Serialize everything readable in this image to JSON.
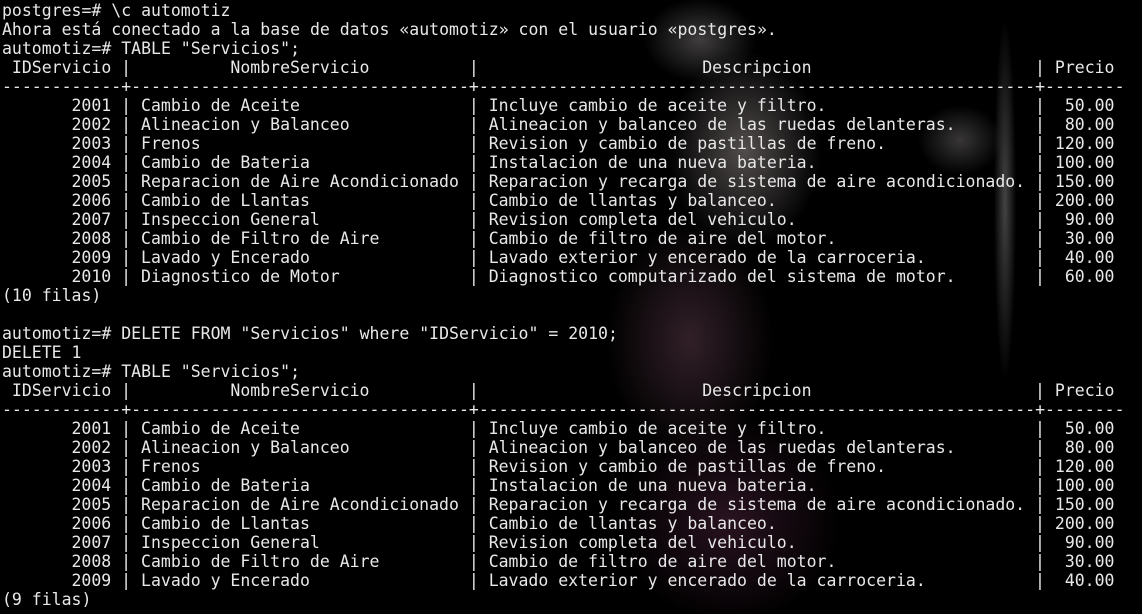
{
  "session": {
    "cmd_connect": "postgres=# \\c automotiz",
    "connect_msg": "Ahora está conectado a la base de datos «automotiz» con el usuario «postgres».",
    "cmd_table1": "automotiz=# TABLE \"Servicios\";",
    "count1": "(10 filas)",
    "cmd_delete": "automotiz=# DELETE FROM \"Servicios\" where \"IDServicio\" = 2010;",
    "delete_result": "DELETE 1",
    "cmd_table2": "automotiz=# TABLE \"Servicios\";",
    "count2": "(9 filas)"
  },
  "table": {
    "sep": "|",
    "headers": [
      "IDServicio",
      "NombreServicio",
      "Descripcion",
      "Precio"
    ],
    "divider": "------------+----------------------------------+--------------------------------------------------------+--------",
    "rows1": [
      [
        "2001",
        "Cambio de Aceite",
        "Incluye cambio de aceite y filtro.",
        "50.00"
      ],
      [
        "2002",
        "Alineacion y Balanceo",
        "Alineacion y balanceo de las ruedas delanteras.",
        "80.00"
      ],
      [
        "2003",
        "Frenos",
        "Revision y cambio de pastillas de freno.",
        "120.00"
      ],
      [
        "2004",
        "Cambio de Bateria",
        "Instalacion de una nueva bateria.",
        "100.00"
      ],
      [
        "2005",
        "Reparacion de Aire Acondicionado",
        "Reparacion y recarga de sistema de aire acondicionado.",
        "150.00"
      ],
      [
        "2006",
        "Cambio de Llantas",
        "Cambio de llantas y balanceo.",
        "200.00"
      ],
      [
        "2007",
        "Inspeccion General",
        "Revision completa del vehiculo.",
        "90.00"
      ],
      [
        "2008",
        "Cambio de Filtro de Aire",
        "Cambio de filtro de aire del motor.",
        "30.00"
      ],
      [
        "2009",
        "Lavado y Encerado",
        "Lavado exterior y encerado de la carroceria.",
        "40.00"
      ],
      [
        "2010",
        "Diagnostico de Motor",
        "Diagnostico computarizado del sistema de motor.",
        "60.00"
      ]
    ],
    "rows2": [
      [
        "2001",
        "Cambio de Aceite",
        "Incluye cambio de aceite y filtro.",
        "50.00"
      ],
      [
        "2002",
        "Alineacion y Balanceo",
        "Alineacion y balanceo de las ruedas delanteras.",
        "80.00"
      ],
      [
        "2003",
        "Frenos",
        "Revision y cambio de pastillas de freno.",
        "120.00"
      ],
      [
        "2004",
        "Cambio de Bateria",
        "Instalacion de una nueva bateria.",
        "100.00"
      ],
      [
        "2005",
        "Reparacion de Aire Acondicionado",
        "Reparacion y recarga de sistema de aire acondicionado.",
        "150.00"
      ],
      [
        "2006",
        "Cambio de Llantas",
        "Cambio de llantas y balanceo.",
        "200.00"
      ],
      [
        "2007",
        "Inspeccion General",
        "Revision completa del vehiculo.",
        "90.00"
      ],
      [
        "2008",
        "Cambio de Filtro de Aire",
        "Cambio de filtro de aire del motor.",
        "30.00"
      ],
      [
        "2009",
        "Lavado y Encerado",
        "Lavado exterior y encerado de la carroceria.",
        "40.00"
      ]
    ]
  }
}
